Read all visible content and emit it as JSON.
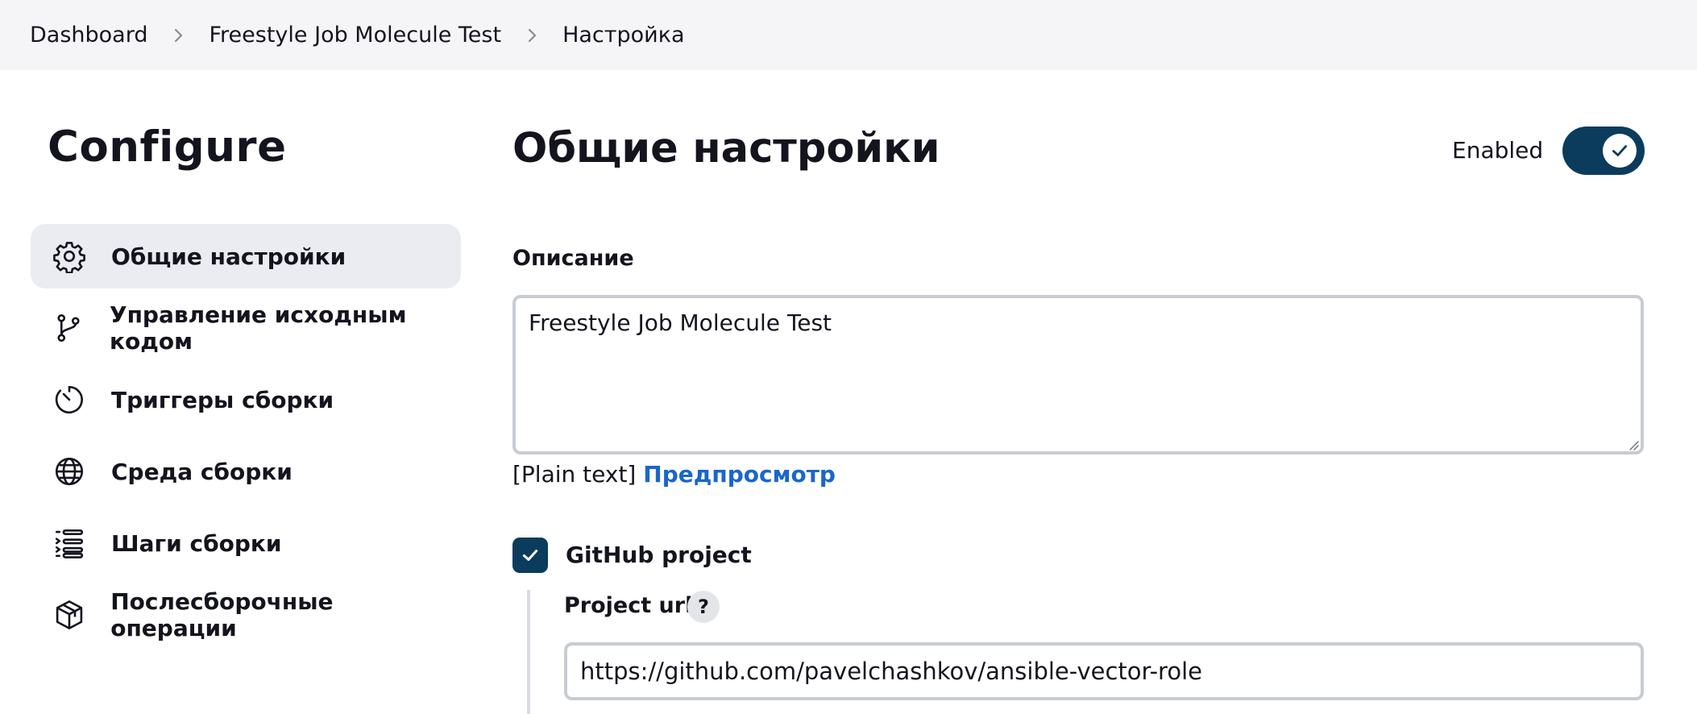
{
  "breadcrumb": {
    "items": [
      "Dashboard",
      "Freestyle Job Molecule Test",
      "Настройка"
    ],
    "separator_icon": "chevron-right-icon"
  },
  "sidebar": {
    "title": "Configure",
    "items": [
      {
        "label": "Общие настройки",
        "icon": "gear-icon",
        "active": true
      },
      {
        "label": "Управление исходным кодом",
        "icon": "git-branch-icon",
        "active": false
      },
      {
        "label": "Триггеры сборки",
        "icon": "timer-icon",
        "active": false
      },
      {
        "label": "Среда сборки",
        "icon": "globe-icon",
        "active": false
      },
      {
        "label": "Шаги сборки",
        "icon": "steps-list-icon",
        "active": false
      },
      {
        "label": "Послесборочные операции",
        "icon": "package-icon",
        "active": false
      }
    ]
  },
  "main": {
    "title": "Общие настройки",
    "enabled_label": "Enabled",
    "enabled": true,
    "description": {
      "label": "Описание",
      "value": "Freestyle Job Molecule Test",
      "format_text": "[Plain text]",
      "preview_link": "Предпросмотр"
    },
    "github_project": {
      "label": "GitHub project",
      "checked": true,
      "project_url_label": "Project url",
      "help": "?",
      "project_url_value": "https://github.com/pavelchashkov/ansible-vector-role"
    }
  },
  "colors": {
    "accent": "#0b3c5d",
    "link": "#1a66cc",
    "active_nav_bg": "#ebecf1",
    "breadcrumb_bg": "#f5f5f7"
  }
}
